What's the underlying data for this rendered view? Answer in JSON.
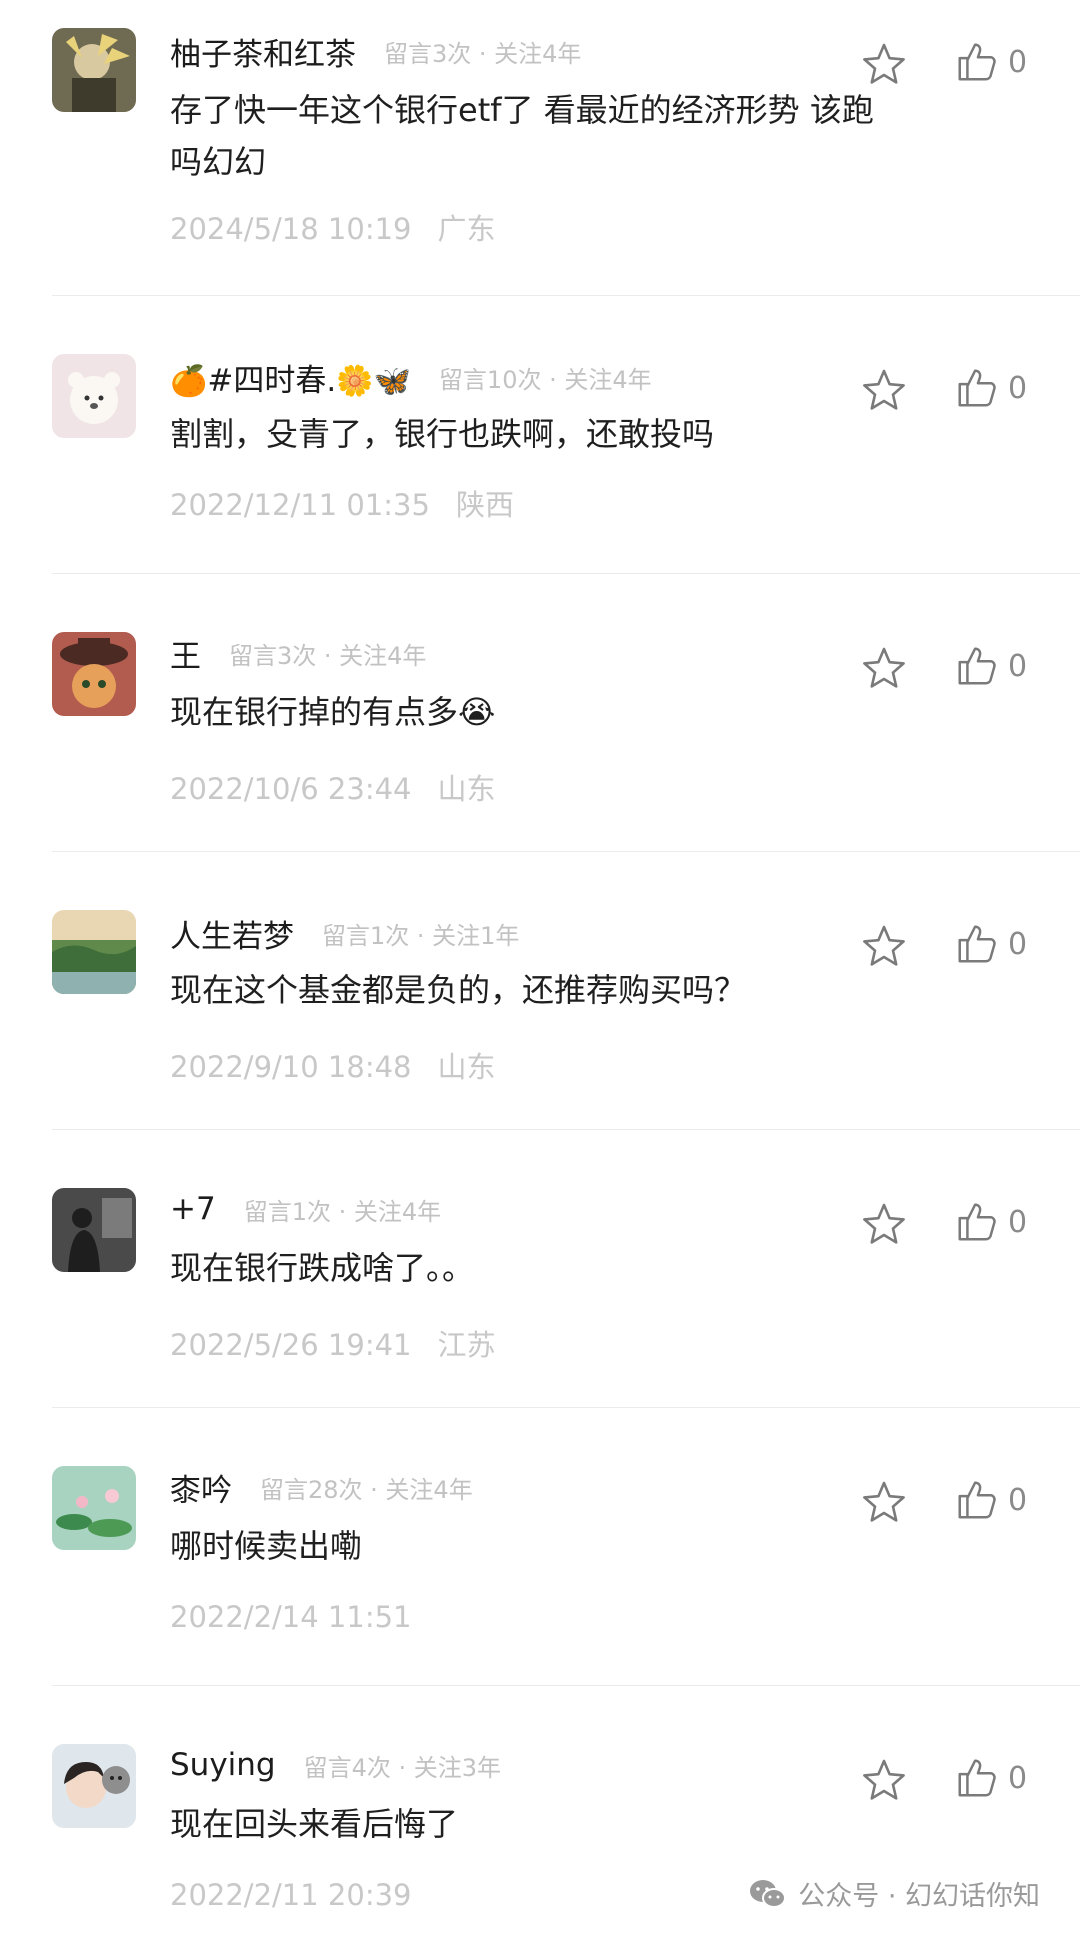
{
  "comments": [
    {
      "nickname": "柚子茶和红茶",
      "nickname_emoji": "",
      "meta": "留言3次 · 关注4年",
      "text": "存了快一年这个银行etf了 看最近的经济形势 该跑吗幻幻",
      "date": "2024/5/18 10:19",
      "location": "广东",
      "likes": "0",
      "avatar_icon": "anime-character-avatar"
    },
    {
      "nickname": "#四时春.",
      "nickname_emoji_pre": "🍊",
      "nickname_emoji": "🌼🦋",
      "meta": "留言10次 · 关注4年",
      "text": "割割，殳青了，银行也跌啊，还敢投吗",
      "date": "2022/12/11 01:35",
      "location": "陕西",
      "likes": "0",
      "avatar_icon": "white-bear-avatar"
    },
    {
      "nickname": "王",
      "meta": "留言3次 · 关注4年",
      "text": "现在银行掉的有点多",
      "text_emoji": "😭",
      "date": "2022/10/6 23:44",
      "location": "山东",
      "likes": "0",
      "avatar_icon": "cat-in-hat-avatar"
    },
    {
      "nickname": "人生若梦",
      "meta": "留言1次 · 关注1年",
      "text": "现在这个基金都是负的，还推荐购买吗？",
      "date": "2022/9/10 18:48",
      "location": "山东",
      "likes": "0",
      "avatar_icon": "landscape-avatar"
    },
    {
      "nickname": "+7",
      "meta": "留言1次 · 关注4年",
      "text": "现在银行跌成啥了。。",
      "date": "2022/5/26 19:41",
      "location": "江苏",
      "likes": "0",
      "avatar_icon": "silhouette-avatar"
    },
    {
      "nickname": "桼吟",
      "meta": "留言28次 · 关注4年",
      "text": "哪时候卖出嘞",
      "date": "2022/2/14 11:51",
      "location": "",
      "likes": "0",
      "avatar_icon": "lotus-pond-avatar"
    },
    {
      "nickname": "Suying",
      "meta": "留言4次 · 关注3年",
      "text": "现在回头来看后悔了",
      "date": "2022/2/11 20:39",
      "location": "",
      "likes": "0",
      "avatar_icon": "girl-with-cat-avatar"
    }
  ],
  "watermark": {
    "text": "公众号 · 幻幻话你知",
    "icon": "wechat-icon"
  },
  "colors": {
    "meta_gray": "#c2c2c2",
    "divider": "#ececec",
    "icon_gray": "#7a7a7a"
  }
}
